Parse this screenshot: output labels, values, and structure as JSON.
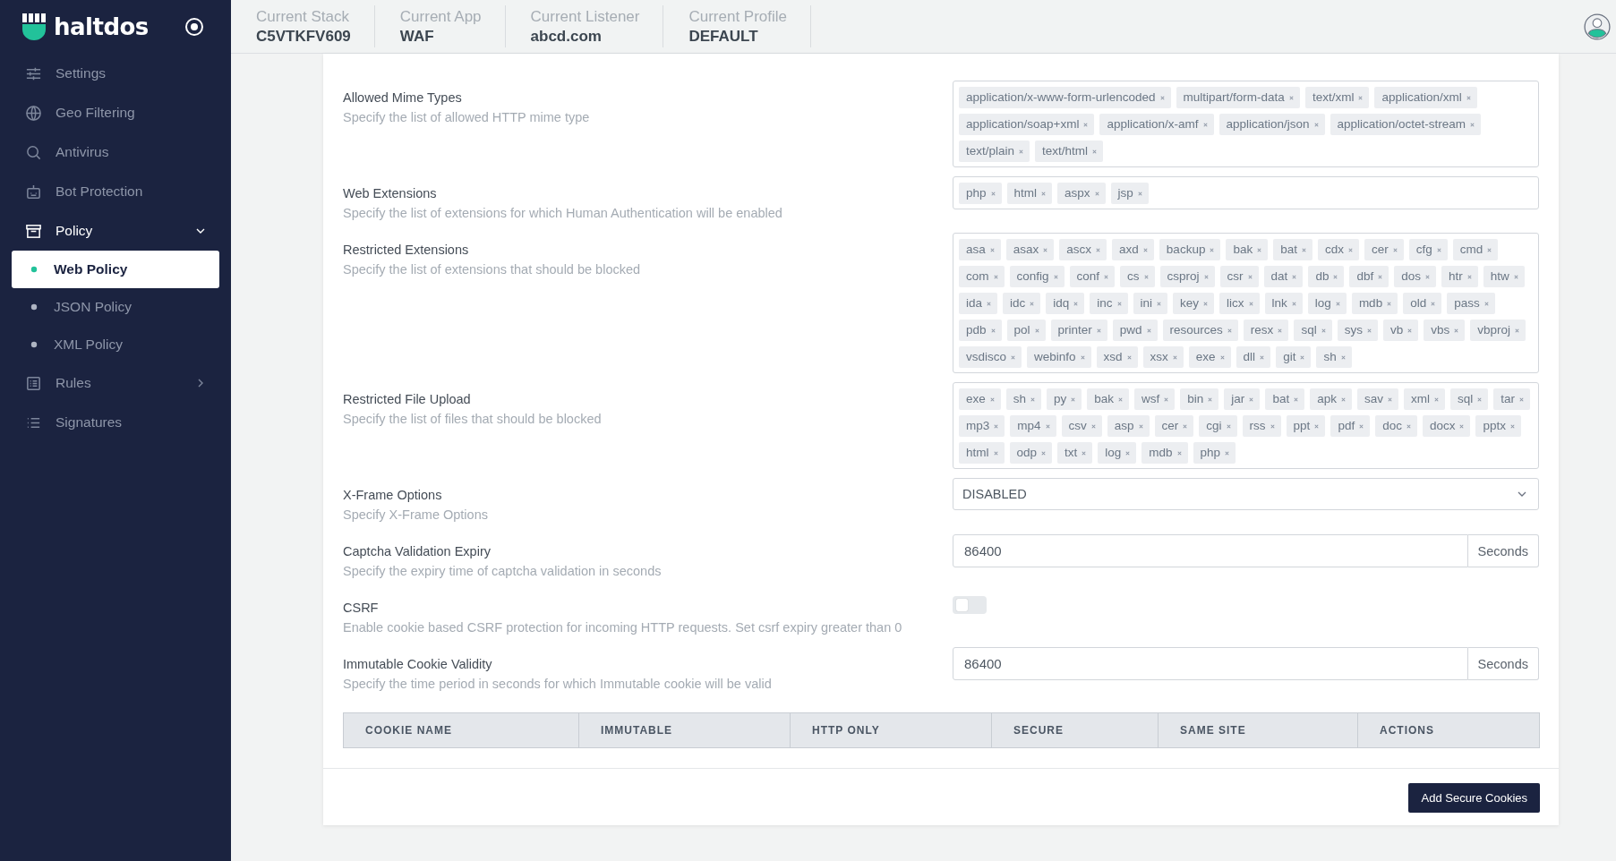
{
  "brand": {
    "name": "haltdos"
  },
  "header": {
    "stats": [
      {
        "label": "Current Stack",
        "value": "C5VTKFV609"
      },
      {
        "label": "Current App",
        "value": "WAF"
      },
      {
        "label": "Current Listener",
        "value": "abcd.com"
      },
      {
        "label": "Current Profile",
        "value": "DEFAULT"
      }
    ]
  },
  "sidebar": {
    "items": [
      {
        "label": "Settings"
      },
      {
        "label": "Geo Filtering"
      },
      {
        "label": "Antivirus"
      },
      {
        "label": "Bot Protection"
      },
      {
        "label": "Policy",
        "expanded": true,
        "children": [
          {
            "label": "Web Policy",
            "selected": true
          },
          {
            "label": "JSON Policy",
            "selected": false
          },
          {
            "label": "XML Policy",
            "selected": false
          }
        ]
      },
      {
        "label": "Rules",
        "expanded": false
      },
      {
        "label": "Signatures"
      }
    ]
  },
  "settings": [
    {
      "kind": "tags",
      "label": "Allowed Mime Types",
      "description": "Specify the list of allowed HTTP mime type",
      "tags": [
        "application/x-www-form-urlencoded",
        "multipart/form-data",
        "text/xml",
        "application/xml",
        "application/soap+xml",
        "application/x-amf",
        "application/json",
        "application/octet-stream",
        "text/plain",
        "text/html"
      ]
    },
    {
      "kind": "tags",
      "label": "Web Extensions",
      "description": "Specify the list of extensions for which Human Authentication will be enabled",
      "tags": [
        "php",
        "html",
        "aspx",
        "jsp"
      ]
    },
    {
      "kind": "tags",
      "label": "Restricted Extensions",
      "description": "Specify the list of extensions that should be blocked",
      "tags": [
        "asa",
        "asax",
        "ascx",
        "axd",
        "backup",
        "bak",
        "bat",
        "cdx",
        "cer",
        "cfg",
        "cmd",
        "com",
        "config",
        "conf",
        "cs",
        "csproj",
        "csr",
        "dat",
        "db",
        "dbf",
        "dos",
        "htr",
        "htw",
        "ida",
        "idc",
        "idq",
        "inc",
        "ini",
        "key",
        "licx",
        "lnk",
        "log",
        "mdb",
        "old",
        "pass",
        "pdb",
        "pol",
        "printer",
        "pwd",
        "resources",
        "resx",
        "sql",
        "sys",
        "vb",
        "vbs",
        "vbproj",
        "vsdisco",
        "webinfo",
        "xsd",
        "xsx",
        "exe",
        "dll",
        "git",
        "sh"
      ]
    },
    {
      "kind": "tags",
      "label": "Restricted File Upload",
      "description": "Specify the list of files that should be blocked",
      "tags": [
        "exe",
        "sh",
        "py",
        "bak",
        "wsf",
        "bin",
        "jar",
        "bat",
        "apk",
        "sav",
        "xml",
        "sql",
        "tar",
        "mp3",
        "mp4",
        "csv",
        "asp",
        "cer",
        "cgi",
        "rss",
        "ppt",
        "pdf",
        "doc",
        "docx",
        "pptx",
        "html",
        "odp",
        "txt",
        "log",
        "mdb",
        "php"
      ]
    },
    {
      "kind": "select",
      "label": "X-Frame Options",
      "description": "Specify X-Frame Options",
      "value": "DISABLED"
    },
    {
      "kind": "number",
      "label": "Captcha Validation Expiry",
      "description": "Specify the expiry time of captcha validation in seconds",
      "value": "86400",
      "unit": "Seconds"
    },
    {
      "kind": "toggle",
      "label": "CSRF",
      "description": "Enable cookie based CSRF protection for incoming HTTP requests. Set csrf expiry greater than 0",
      "on": false
    },
    {
      "kind": "number",
      "label": "Immutable Cookie Validity",
      "description": "Specify the time period in seconds for which Immutable cookie will be valid",
      "value": "86400",
      "unit": "Seconds"
    }
  ],
  "cookie_table": {
    "columns": [
      "COOKIE NAME",
      "IMMUTABLE",
      "HTTP ONLY",
      "SECURE",
      "SAME SITE",
      "ACTIONS"
    ]
  },
  "footer": {
    "button": "Add Secure Cookies"
  }
}
